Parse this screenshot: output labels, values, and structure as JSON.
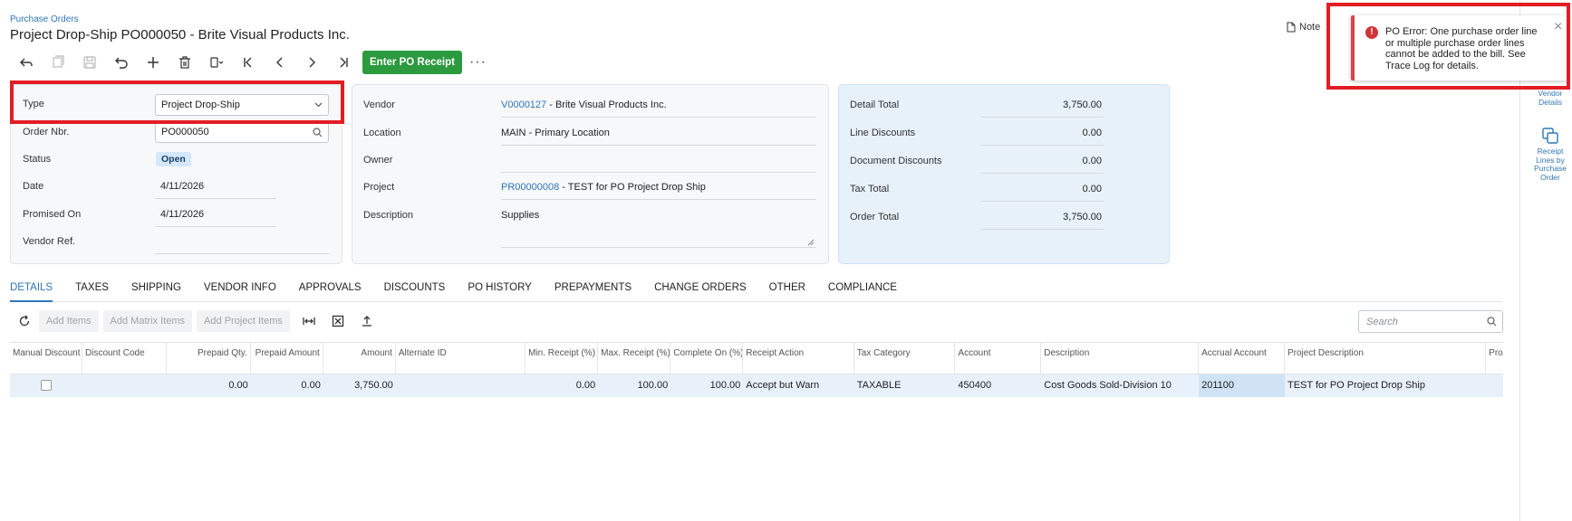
{
  "header": {
    "breadcrumb": "Purchase Orders",
    "title": "Project Drop-Ship PO000050 - Brite Visual Products Inc.",
    "notes_label": "Note"
  },
  "toolbar": {
    "primary_label": "Enter PO Receipt",
    "more_label": "···"
  },
  "summary": {
    "type_label": "Type",
    "type_value": "Project Drop-Ship",
    "order_nbr_label": "Order Nbr.",
    "order_nbr_value": "PO000050",
    "status_label": "Status",
    "status_value": "Open",
    "date_label": "Date",
    "date_value": "4/11/2026",
    "promised_label": "Promised On",
    "promised_value": "4/11/2026",
    "vendor_ref_label": "Vendor Ref.",
    "vendor_ref_value": ""
  },
  "vendor": {
    "vendor_label": "Vendor",
    "vendor_code": "V0000127",
    "vendor_name": " - Brite Visual Products Inc.",
    "location_label": "Location",
    "location_value": "MAIN - Primary Location",
    "owner_label": "Owner",
    "owner_value": "",
    "project_label": "Project",
    "project_code": "PR00000008",
    "project_name": " - TEST for PO Project Drop Ship",
    "description_label": "Description",
    "description_value": "Supplies"
  },
  "totals": {
    "detail_total_label": "Detail Total",
    "detail_total": "3,750.00",
    "line_discounts_label": "Line Discounts",
    "line_discounts": "0.00",
    "document_discounts_label": "Document Discounts",
    "document_discounts": "0.00",
    "tax_total_label": "Tax Total",
    "tax_total": "0.00",
    "order_total_label": "Order Total",
    "order_total": "3,750.00"
  },
  "tabs": [
    "DETAILS",
    "TAXES",
    "SHIPPING",
    "VENDOR INFO",
    "APPROVALS",
    "DISCOUNTS",
    "PO HISTORY",
    "PREPAYMENTS",
    "CHANGE ORDERS",
    "OTHER",
    "COMPLIANCE"
  ],
  "grid_toolbar": {
    "add_items": "Add Items",
    "add_matrix_items": "Add Matrix Items",
    "add_project_items": "Add Project Items",
    "search_placeholder": "Search"
  },
  "grid": {
    "columns": [
      "Manual Discount",
      "Discount Code",
      "Prepaid Qty.",
      "Prepaid Amount",
      "Amount",
      "Alternate ID",
      "Min. Receipt (%)",
      "Max. Receipt (%)",
      "Complete On (%)",
      "Receipt Action",
      "Tax Category",
      "Account",
      "Description",
      "Accrual Account",
      "Project Description",
      "Pro"
    ],
    "row": {
      "discount_code": "",
      "prepaid_qty": "0.00",
      "prepaid_amount": "0.00",
      "amount": "3,750.00",
      "alternate_id": "",
      "min_receipt": "0.00",
      "max_receipt": "100.00",
      "complete_on": "100.00",
      "receipt_action": "Accept but Warn",
      "tax_category": "TAXABLE",
      "account": "450400",
      "description": "Cost Goods Sold-Division 10",
      "accrual_account": "201100",
      "project_description": "TEST for PO Project Drop Ship",
      "pro": ""
    }
  },
  "side_panel": {
    "vendor_details": "Vendor Details",
    "receipt_lines": "Receipt Lines by Purchase Order"
  },
  "toast": {
    "message": "PO Error: One purchase order line or multiple purchase order lines cannot be added to the bill. See Trace Log for details."
  },
  "colors": {
    "accent": "#2f76b5",
    "primary_button": "#2c9a3f",
    "highlight_red": "#e21d23",
    "error": "#d13438"
  }
}
